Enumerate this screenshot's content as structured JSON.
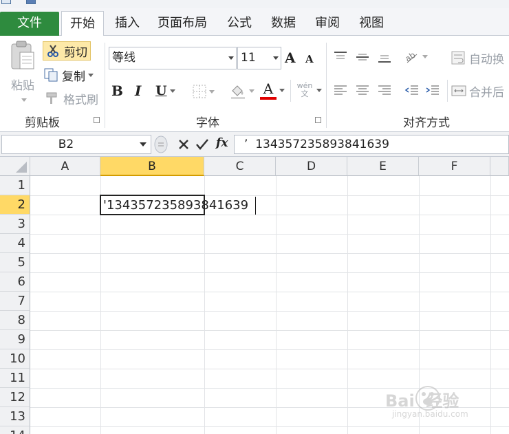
{
  "ribbon_tabs": [
    "文件",
    "开始",
    "插入",
    "页面布局",
    "公式",
    "数据",
    "审阅",
    "视图"
  ],
  "clipboard": {
    "paste_label": "粘贴",
    "cut_label": "剪切",
    "copy_label": "复制",
    "format_painter_label": "格式刷",
    "group_label": "剪贴板"
  },
  "font": {
    "font_name": "等线",
    "font_size": "11",
    "group_label": "字体",
    "bold": "B",
    "italic": "I",
    "underline": "U",
    "font_color_letter": "A",
    "font_color": "#e00000",
    "phonetic_label": "wén 文"
  },
  "alignment": {
    "wrap_text_label": "自动换",
    "merge_label": "合并后",
    "group_label": "对齐方式"
  },
  "formula_bar": {
    "name_box": "B2",
    "fx_label": "fx",
    "content": "’  134357235893841639"
  },
  "sheet": {
    "columns": [
      "A",
      "B",
      "C",
      "D",
      "E",
      "F"
    ],
    "rows": [
      "1",
      "2",
      "3",
      "4",
      "5",
      "6",
      "7",
      "8",
      "9",
      "10",
      "11",
      "12",
      "13",
      "14"
    ],
    "active_cell_ref": "B2",
    "active_cell_text": "'134357235893841639"
  },
  "colors": {
    "file_tab": "#2e8b3e",
    "selected_header": "#ffd966",
    "cut_highlight": "#fde9a8"
  },
  "watermark": {
    "brand": "Bai  经验",
    "url": "jingyan.baidu.com"
  }
}
